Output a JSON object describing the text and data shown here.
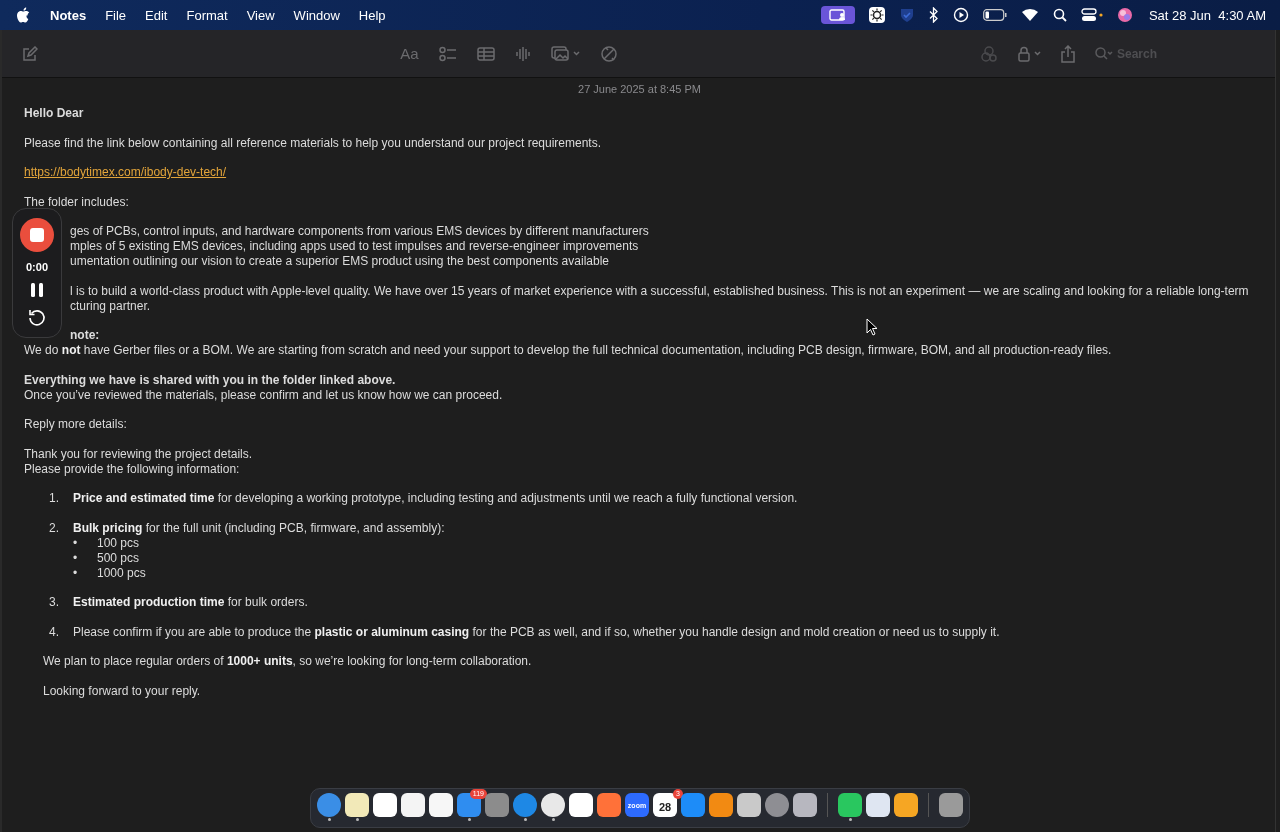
{
  "menubar": {
    "menus": [
      {
        "label": "Notes",
        "app": true
      },
      {
        "label": "File",
        "app": false
      },
      {
        "label": "Edit",
        "app": false
      },
      {
        "label": "Format",
        "app": false
      },
      {
        "label": "View",
        "app": false
      },
      {
        "label": "Window",
        "app": false
      },
      {
        "label": "Help",
        "app": false
      }
    ],
    "clock": "Sat 28 Jun  4:30 AM"
  },
  "toolbar": {
    "format_label": "Aa",
    "search": {
      "placeholder": "Search"
    }
  },
  "note": {
    "date": "27 June 2025 at 8:45 PM",
    "paragraphs": [
      [
        {
          "kind": "plain",
          "bold": true,
          "text": "Hello Dear"
        }
      ],
      [
        {
          "kind": "plain",
          "text": "Please find the link below containing all reference materials to help you understand our project requirements."
        }
      ],
      [
        {
          "kind": "link",
          "text": "https://bodytimex.com/ibody-dev-tech/"
        }
      ],
      [
        {
          "kind": "plain",
          "text": "The folder includes:"
        }
      ],
      [
        {
          "kind": "cut",
          "text": "ges of PCBs, control inputs, and hardware components from various EMS devices by different manufacturers"
        },
        {
          "kind": "cut",
          "text": "mples of 5 existing EMS devices, including apps used to test impulses and reverse-engineer improvements"
        },
        {
          "kind": "cut",
          "text": "umentation outlining our vision to create a superior EMS product using the best components available"
        }
      ],
      [
        {
          "kind": "cut",
          "text": "l is to build a world-class product with Apple-level quality. We have over 15 years of market experience with a successful, established business. This is not an experiment — we are scaling and looking for a reliable long-term"
        },
        {
          "kind": "cut",
          "text": "cturing partner."
        }
      ],
      [
        {
          "kind": "cut",
          "bold": true,
          "text": "note:"
        },
        {
          "kind": "plain",
          "text": "We do **not** have Gerber files or a BOM. We are starting from scratch and need your support to develop the full technical documentation, including PCB design, firmware, BOM, and all production-ready files."
        }
      ],
      [
        {
          "kind": "plain",
          "bold": true,
          "text": "Everything we have is shared with you in the folder linked above."
        },
        {
          "kind": "plain",
          "text": "Once you’ve reviewed the materials, please confirm and let us know how we can proceed."
        }
      ],
      [
        {
          "kind": "plain",
          "text": "Reply more details:"
        }
      ],
      [
        {
          "kind": "plain",
          "text": "Thank you for reviewing the project details."
        },
        {
          "kind": "plain",
          "text": "Please provide the following information:"
        }
      ],
      [
        {
          "kind": "numbered",
          "marker": "1.",
          "text": "**Price and estimated time** for developing a working prototype, including testing and adjustments until we reach a fully functional version."
        }
      ],
      [
        {
          "kind": "numbered",
          "marker": "2.",
          "text": "**Bulk pricing** for the full unit (including PCB, firmware, and assembly):"
        },
        {
          "kind": "bullet",
          "marker": "•",
          "text": "100 pcs"
        },
        {
          "kind": "bullet",
          "marker": "•",
          "text": "500 pcs"
        },
        {
          "kind": "bullet",
          "marker": "•",
          "text": "1000 pcs"
        }
      ],
      [
        {
          "kind": "numbered",
          "marker": "3.",
          "text": "**Estimated production time** for bulk orders."
        }
      ],
      [
        {
          "kind": "numbered",
          "marker": "4.",
          "text": "Please confirm if you are able to produce the **plastic or aluminum casing** for the PCB as well, and if so, whether you handle design and mold creation or need us to supply it."
        }
      ],
      [
        {
          "kind": "indented",
          "text": "We plan to place regular orders of **1000+ units**, so we’re looking for long-term collaboration."
        }
      ],
      [
        {
          "kind": "indented",
          "text": "Looking forward to your reply."
        }
      ]
    ]
  },
  "recorder": {
    "time": "0:00"
  },
  "dock": [
    {
      "kind": "finder",
      "color": "#3a8ee6",
      "running": true
    },
    {
      "kind": "notes",
      "color": "#f2e9b8",
      "running": true
    },
    {
      "kind": "editor",
      "color": "#ffffff",
      "running": false
    },
    {
      "kind": "board",
      "color": "#f4f4f4",
      "running": false
    },
    {
      "kind": "reminders",
      "color": "#f7f7f7",
      "running": false
    },
    {
      "kind": "mail",
      "color": "#2f8df0",
      "running": true,
      "badge": "119"
    },
    {
      "kind": "launchpad",
      "color": "#8c8c8c",
      "running": false
    },
    {
      "kind": "safari",
      "color": "#1e88e5",
      "running": true
    },
    {
      "kind": "chrome",
      "color": "#e8e8e8",
      "running": true
    },
    {
      "kind": "brave",
      "color": "#ffffff",
      "running": false
    },
    {
      "kind": "firefox",
      "color": "#ff7139",
      "running": false
    },
    {
      "kind": "zoom",
      "color": "#2d6bff",
      "running": false,
      "label": "zoom"
    },
    {
      "kind": "calendar",
      "color": "#ffffff",
      "running": false,
      "label": "28",
      "badge": "3"
    },
    {
      "kind": "appstore",
      "color": "#1d8cf8",
      "running": false
    },
    {
      "kind": "books",
      "color": "#f28a12",
      "running": false
    },
    {
      "kind": "calculator",
      "color": "#c9c9c9",
      "running": false
    },
    {
      "kind": "settings",
      "color": "#8e8e93",
      "running": false
    },
    {
      "kind": "mirror",
      "color": "#b7b7bf",
      "running": false
    },
    {
      "kind": "divider"
    },
    {
      "kind": "whatsapp",
      "color": "#29c75f",
      "running": true
    },
    {
      "kind": "preview",
      "color": "#dfe6f2",
      "running": false
    },
    {
      "kind": "pages",
      "color": "#f6a623",
      "running": false
    },
    {
      "kind": "divider"
    },
    {
      "kind": "trash",
      "color": "#9a9a9a",
      "running": false
    }
  ]
}
